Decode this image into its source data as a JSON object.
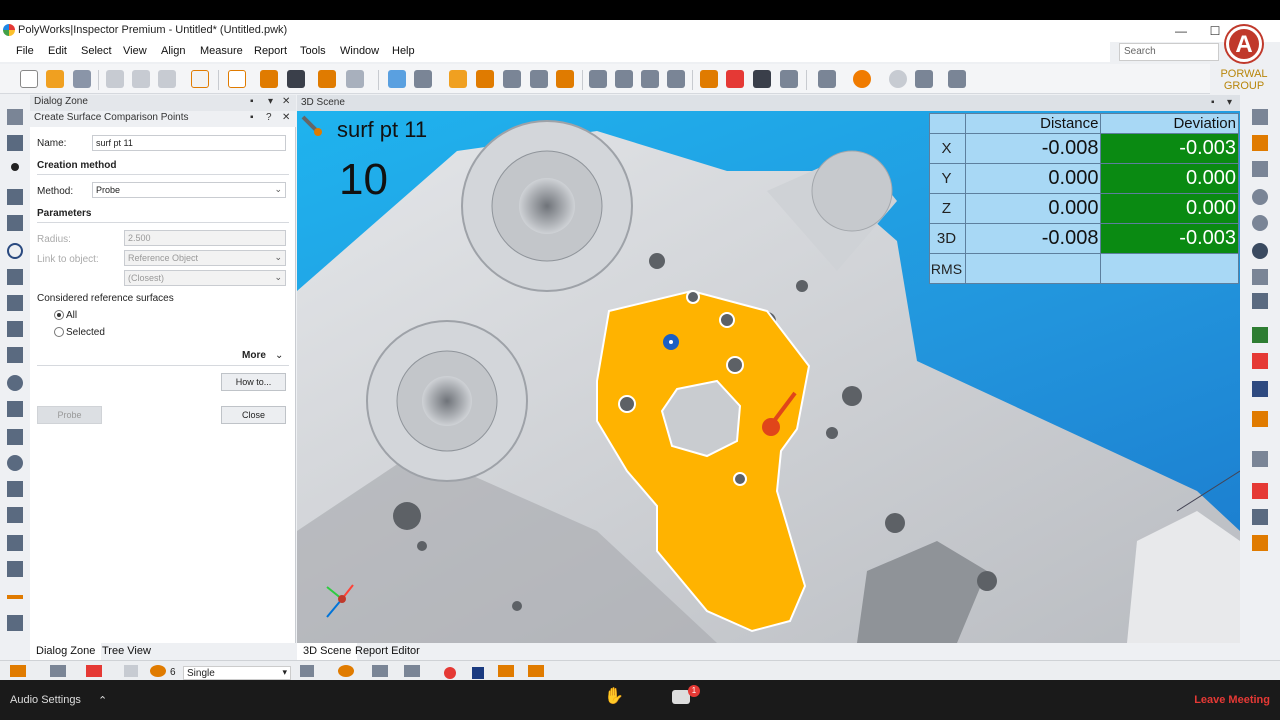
{
  "window": {
    "title": "PolyWorks|Inspector Premium - Untitled* (Untitled.pwk)",
    "minimize": "—",
    "maximize": "☐"
  },
  "menu": [
    "File",
    "Edit",
    "Select",
    "View",
    "Align",
    "Measure",
    "Report",
    "Tools",
    "Window",
    "Help"
  ],
  "search": {
    "placeholder": "Search"
  },
  "logo": {
    "letter": "A",
    "text": "PORWAL GROUP"
  },
  "dialog_zone": {
    "header": "Dialog Zone",
    "panel_title": "Create Surface Comparison Points",
    "name_label": "Name:",
    "name_value": "surf pt 11",
    "creation_method": "Creation method",
    "method_label": "Method:",
    "method_value": "Probe",
    "parameters": "Parameters",
    "radius_label": "Radius:",
    "radius_value": "2.500",
    "link_label": "Link to object:",
    "link_value": "Reference Object",
    "closest_value": "(Closest)",
    "considered_label": "Considered reference surfaces",
    "opt_all": "All",
    "opt_selected": "Selected",
    "more": "More",
    "howto": "How to...",
    "probe": "Probe",
    "close": "Close"
  },
  "bottom_tabs": {
    "dialog_zone": "Dialog Zone",
    "tree_view": "Tree View",
    "scene": "3D Scene",
    "report_editor": "Report Editor"
  },
  "statusbar": {
    "count": "6",
    "mode": "Single"
  },
  "zoom": {
    "audio": "Audio Settings",
    "leave": "Leave Meeting",
    "badge": "1"
  },
  "scene": {
    "header": "3D Scene",
    "feature_name": "surf pt 11",
    "count": "10"
  },
  "result": {
    "col_distance": "Distance",
    "col_deviation": "Deviation",
    "rows": [
      {
        "label": "X",
        "distance": "-0.008",
        "deviation": "-0.003"
      },
      {
        "label": "Y",
        "distance": "0.000",
        "deviation": "0.000"
      },
      {
        "label": "Z",
        "distance": "0.000",
        "deviation": "0.000"
      },
      {
        "label": "3D",
        "distance": "-0.008",
        "deviation": "-0.003"
      }
    ],
    "rms_label": "RMS"
  },
  "colors": {
    "highlight_surface": "#ffb300",
    "deviation_fill": "#0a8a12",
    "distance_fill": "#a8d8f5",
    "scene_bg": "#2294dc",
    "probe": "#e0451a"
  }
}
